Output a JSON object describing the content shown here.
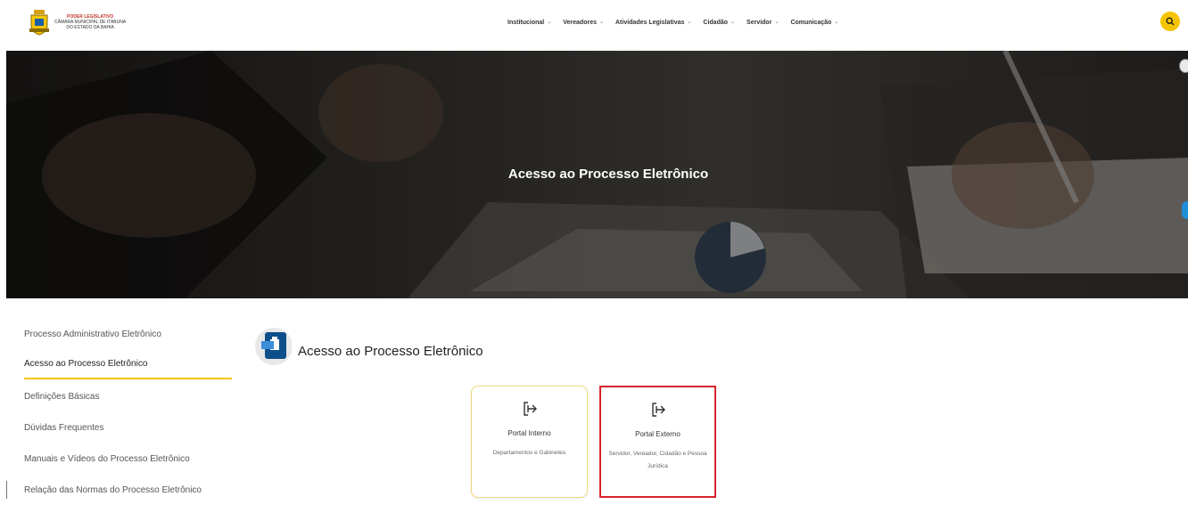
{
  "header": {
    "logo": {
      "line1": "PODER LEGISLATIVO",
      "line2": "CÂMARA MUNICIPAL DE ITABUNA",
      "line3": "DO ESTADO DA BAHIA"
    },
    "nav": [
      {
        "label": "Institucional"
      },
      {
        "label": "Vereadores"
      },
      {
        "label": "Atividades Legislativas"
      },
      {
        "label": "Cidadão"
      },
      {
        "label": "Servidor"
      },
      {
        "label": "Comunicação"
      }
    ],
    "search_icon": "search-icon"
  },
  "hero": {
    "title": "Acesso ao Processo Eletrônico"
  },
  "sidebar": {
    "items": [
      {
        "label": "Processo Administrativo Eletrônico",
        "active": false
      },
      {
        "label": "Acesso ao Processo Eletrônico",
        "active": true
      },
      {
        "label": "Definições Básicas",
        "active": false
      },
      {
        "label": "Dúvidas Frequentes",
        "active": false
      },
      {
        "label": "Manuais e Vídeos do Processo Eletrônico",
        "active": false
      },
      {
        "label": "Relação das Normas do Processo Eletrônico",
        "active": false
      }
    ]
  },
  "main": {
    "title": "Acesso ao Processo Eletrônico",
    "cards": [
      {
        "title": "Portal Interno",
        "desc": "Departamentos e Gabinetes",
        "icon": "login-icon"
      },
      {
        "title": "Portal Externo",
        "desc": "Servidor, Vereador, Cidadão e Pessoa Jurídica",
        "icon": "login-icon"
      }
    ]
  },
  "colors": {
    "accent": "#f5c400",
    "highlight": "#d9222a"
  }
}
